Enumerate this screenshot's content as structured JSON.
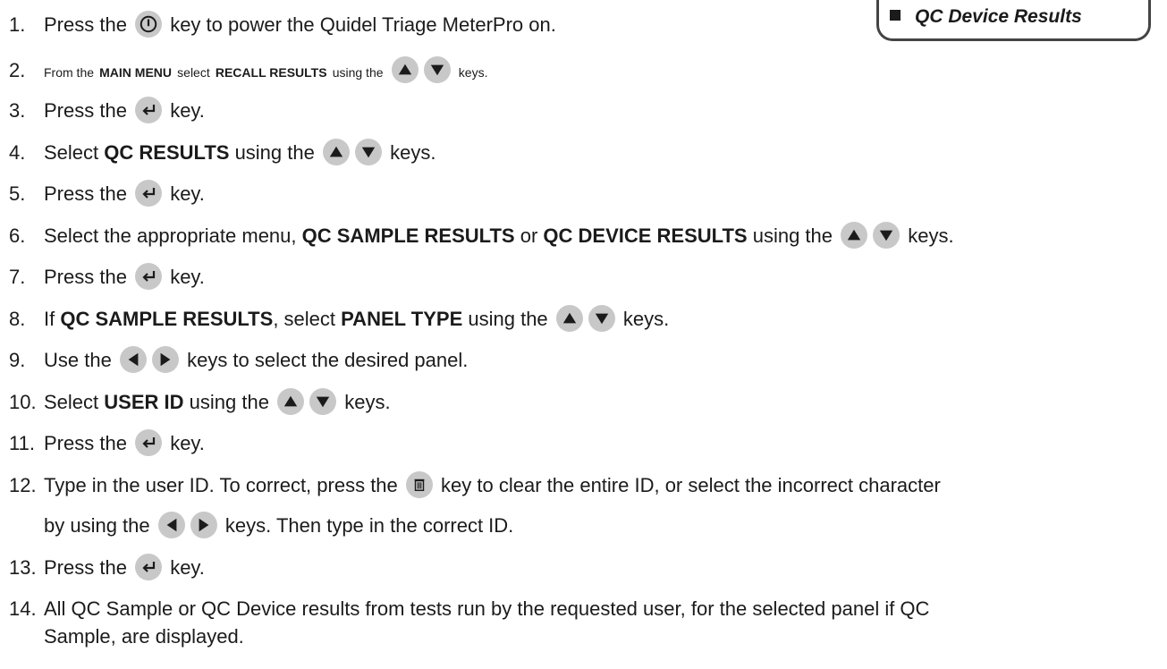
{
  "callout": {
    "item": "QC Device Results"
  },
  "steps": [
    {
      "num": "1.",
      "a": "Press the",
      "b": "key to power the Quidel Triage MeterPro on."
    },
    {
      "num": "2.",
      "a": "From the",
      "b1": "MAIN MENU",
      "c": "select",
      "b2": "RECALL RESULTS",
      "d": "using the",
      "e": "keys."
    },
    {
      "num": "3.",
      "a": "Press the",
      "b": "key."
    },
    {
      "num": "4.",
      "a": "Select",
      "b1": "QC RESULTS",
      "c": "using the",
      "e": "keys."
    },
    {
      "num": "5.",
      "a": "Press the",
      "b": "key."
    },
    {
      "num": "6.",
      "a": "Select the appropriate menu,",
      "b1": "QC SAMPLE RESULTS",
      "c": "or",
      "b2": "QC DEVICE RESULTS",
      "d": "using the",
      "e": "keys."
    },
    {
      "num": "7.",
      "a": "Press the",
      "b": "key."
    },
    {
      "num": "8.",
      "a": "If",
      "b1": "QC SAMPLE RESULTS",
      "c": ", select",
      "b2": "PANEL TYPE",
      "d": "using the",
      "e": "keys."
    },
    {
      "num": "9.",
      "a": "Use the",
      "b": "keys to select the desired panel."
    },
    {
      "num": "10.",
      "a": "Select",
      "b1": "USER ID",
      "c": "using the",
      "e": "keys."
    },
    {
      "num": "11.",
      "a": "Press the",
      "b": "key."
    },
    {
      "num": "12.",
      "a": "Type in the user ID. To correct, press the",
      "b": "key to clear the entire ID, or select the incorrect character",
      "line2a": "by using the",
      "line2b": "keys. Then type in the correct ID."
    },
    {
      "num": "13.",
      "a": "Press the",
      "b": "key."
    },
    {
      "num": "14.",
      "a": "All QC Sample or QC Device results from tests run by the requested user, for the selected panel if QC",
      "line2": "Sample, are displayed."
    }
  ],
  "icons": {
    "power": "power-icon",
    "up": "up-arrow-icon",
    "down": "down-arrow-icon",
    "left": "left-arrow-icon",
    "right": "right-arrow-icon",
    "enter": "enter-icon",
    "delete": "trash-icon"
  },
  "colors": {
    "key_bg": "#c8c8c8",
    "text": "#1b1b1b",
    "border": "#444444"
  }
}
